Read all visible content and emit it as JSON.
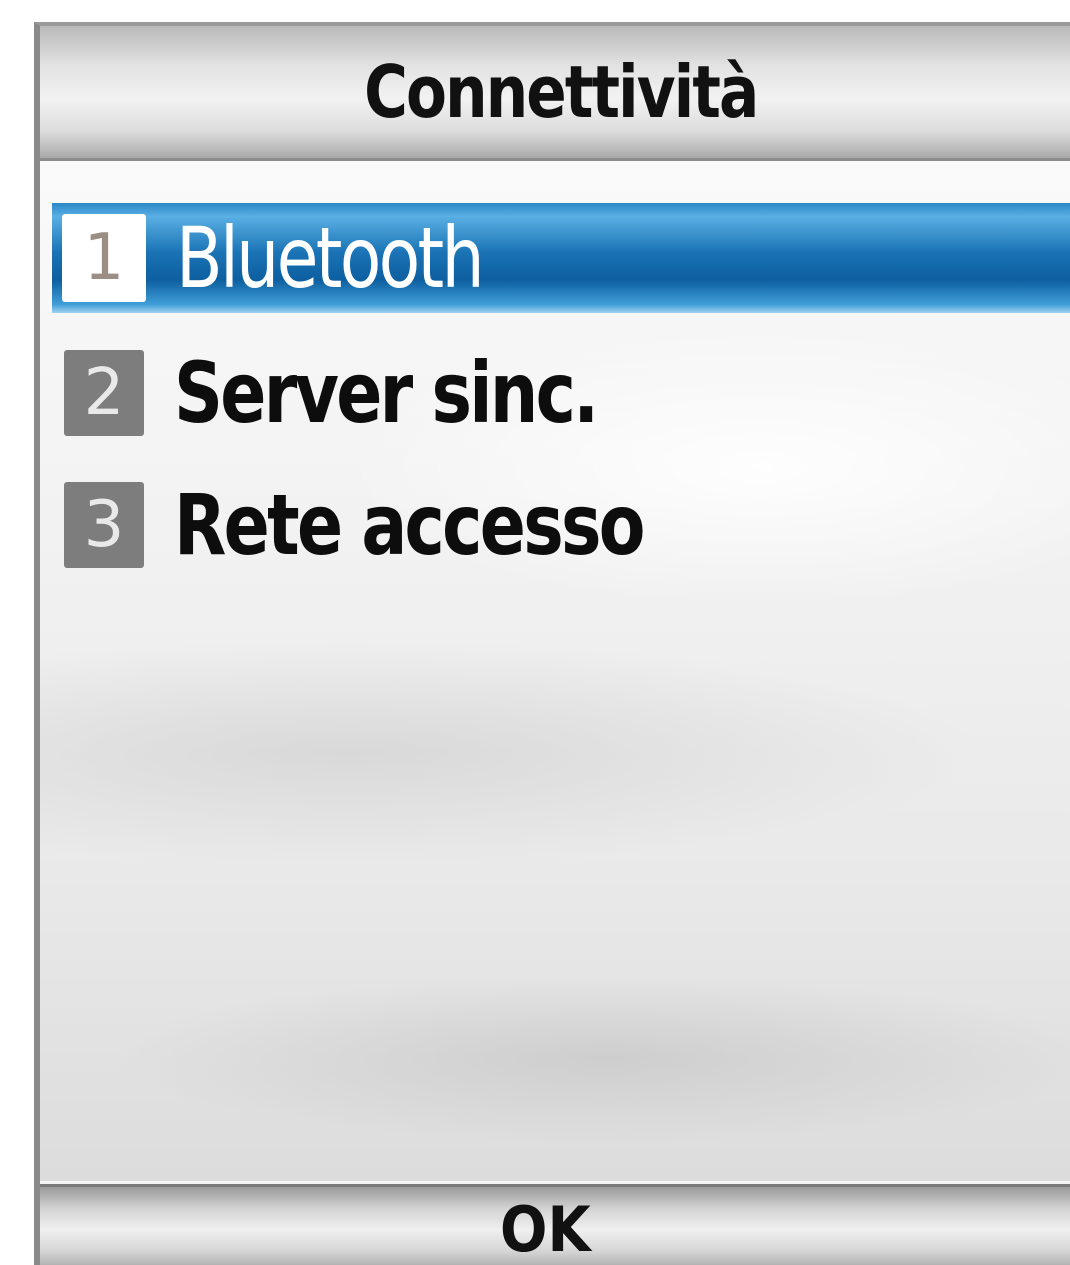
{
  "window": {
    "title": "Connettività"
  },
  "menu": {
    "items": [
      {
        "number": "1",
        "label": "Bluetooth",
        "selected": true
      },
      {
        "number": "2",
        "label": "Server sinc.",
        "selected": false
      },
      {
        "number": "3",
        "label": "Rete accesso",
        "selected": false
      }
    ]
  },
  "softkeys": {
    "center": "OK"
  },
  "colors": {
    "selection": "#1a73b5",
    "badge": "#7d7d7d",
    "text": "#0d0d0d"
  }
}
